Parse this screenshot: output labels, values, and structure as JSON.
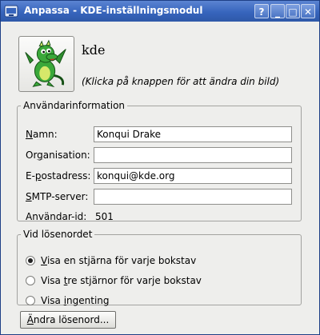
{
  "window": {
    "title": "Anpassa - KDE-inställningsmodul",
    "help_label": "?",
    "minimize_label": "_",
    "maximize_label": "□",
    "close_label": "✕"
  },
  "profile": {
    "username": "kde",
    "hint": "(Klicka på knappen för att ändra din bild)"
  },
  "user_info": {
    "legend": "Användarinformation",
    "name": {
      "pre": "",
      "mnemonic": "N",
      "post": "amn:",
      "value": "Konqui Drake"
    },
    "organisation": {
      "pre": "Or",
      "mnemonic": "g",
      "post": "anisation:",
      "value": ""
    },
    "email": {
      "pre": "E-",
      "mnemonic": "p",
      "post": "ostadress:",
      "value": "konqui@kde.org"
    },
    "smtp": {
      "pre": "",
      "mnemonic": "S",
      "post": "MTP-server:",
      "value": ""
    },
    "userid_label": "Användar-id:",
    "userid_value": "501"
  },
  "password_group": {
    "legend": "Vid lösenordet",
    "options": [
      {
        "pre": "",
        "mnemonic": "V",
        "post": "isa en stjärna för varje bokstav",
        "selected": true
      },
      {
        "pre": "Visa ",
        "mnemonic": "t",
        "post": "re stjärnor för varje bokstav",
        "selected": false
      },
      {
        "pre": "Visa ",
        "mnemonic": "i",
        "post": "ngenting",
        "selected": false
      }
    ]
  },
  "change_password": {
    "pre": "",
    "mnemonic": "Ä",
    "post": "ndra lösenord..."
  },
  "colors": {
    "titlebar": "#3765bd",
    "window_bg": "#eeeeec",
    "border": "#a3a3a0"
  }
}
